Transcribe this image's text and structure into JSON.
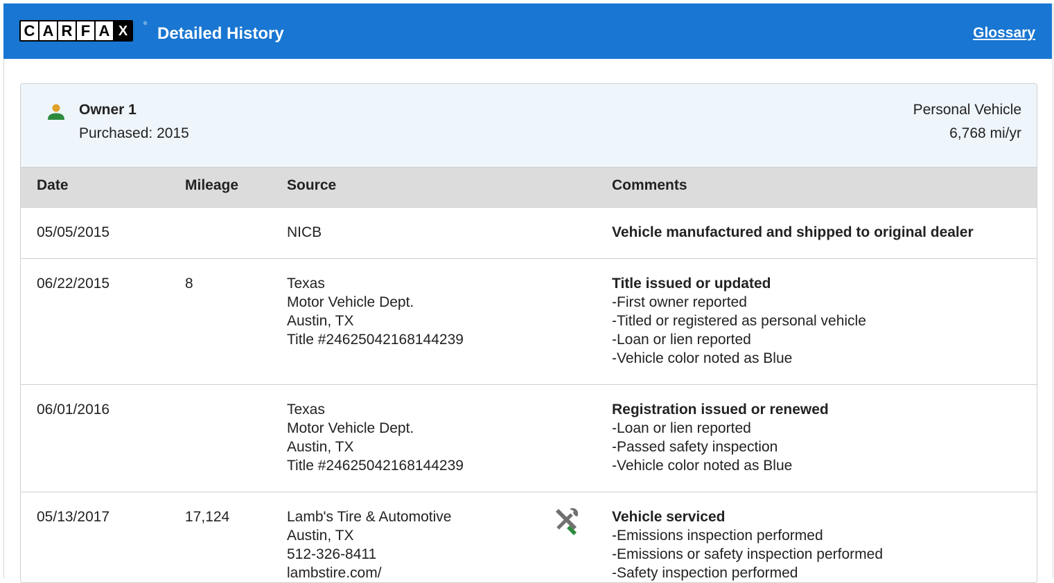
{
  "header": {
    "logo_letters": [
      "C",
      "A",
      "R",
      "F",
      "A",
      "X"
    ],
    "title": "Detailed History",
    "glossary": "Glossary",
    "bg_color": "#1976d2"
  },
  "owner": {
    "name": "Owner 1",
    "purchased": "Purchased: 2015",
    "vehicle_use": "Personal Vehicle",
    "mileage_rate": "6,768 mi/yr",
    "icon": "person-icon",
    "icon_color": "#2e8b3e"
  },
  "table": {
    "columns": [
      "Date",
      "Mileage",
      "Source",
      "Comments"
    ],
    "rows": [
      {
        "date": "05/05/2015",
        "mileage": "",
        "source": [
          "NICB"
        ],
        "icon": "",
        "comment_head": "Vehicle manufactured and shipped to original dealer",
        "comment_items": []
      },
      {
        "date": "06/22/2015",
        "mileage": "8",
        "source": [
          "Texas",
          "Motor Vehicle Dept.",
          "Austin, TX",
          "Title #24625042168144239"
        ],
        "icon": "",
        "comment_head": "Title issued or updated",
        "comment_items": [
          "First owner reported",
          "Titled or registered as personal vehicle",
          "Loan or lien reported",
          "Vehicle color noted as Blue"
        ]
      },
      {
        "date": "06/01/2016",
        "mileage": "",
        "source": [
          "Texas",
          "Motor Vehicle Dept.",
          "Austin, TX",
          "Title #24625042168144239"
        ],
        "icon": "",
        "comment_head": "Registration issued or renewed",
        "comment_items": [
          "Loan or lien reported",
          "Passed safety inspection",
          "Vehicle color noted as Blue"
        ]
      },
      {
        "date": "05/13/2017",
        "mileage": "17,124",
        "source": [
          "Lamb's Tire & Automotive",
          "Austin, TX",
          "512-326-8411",
          "lambstire.com/"
        ],
        "icon": "service-tools-icon",
        "comment_head": "Vehicle serviced",
        "comment_items": [
          "Emissions inspection performed",
          "Emissions or safety inspection performed",
          "Safety inspection performed"
        ]
      }
    ]
  }
}
